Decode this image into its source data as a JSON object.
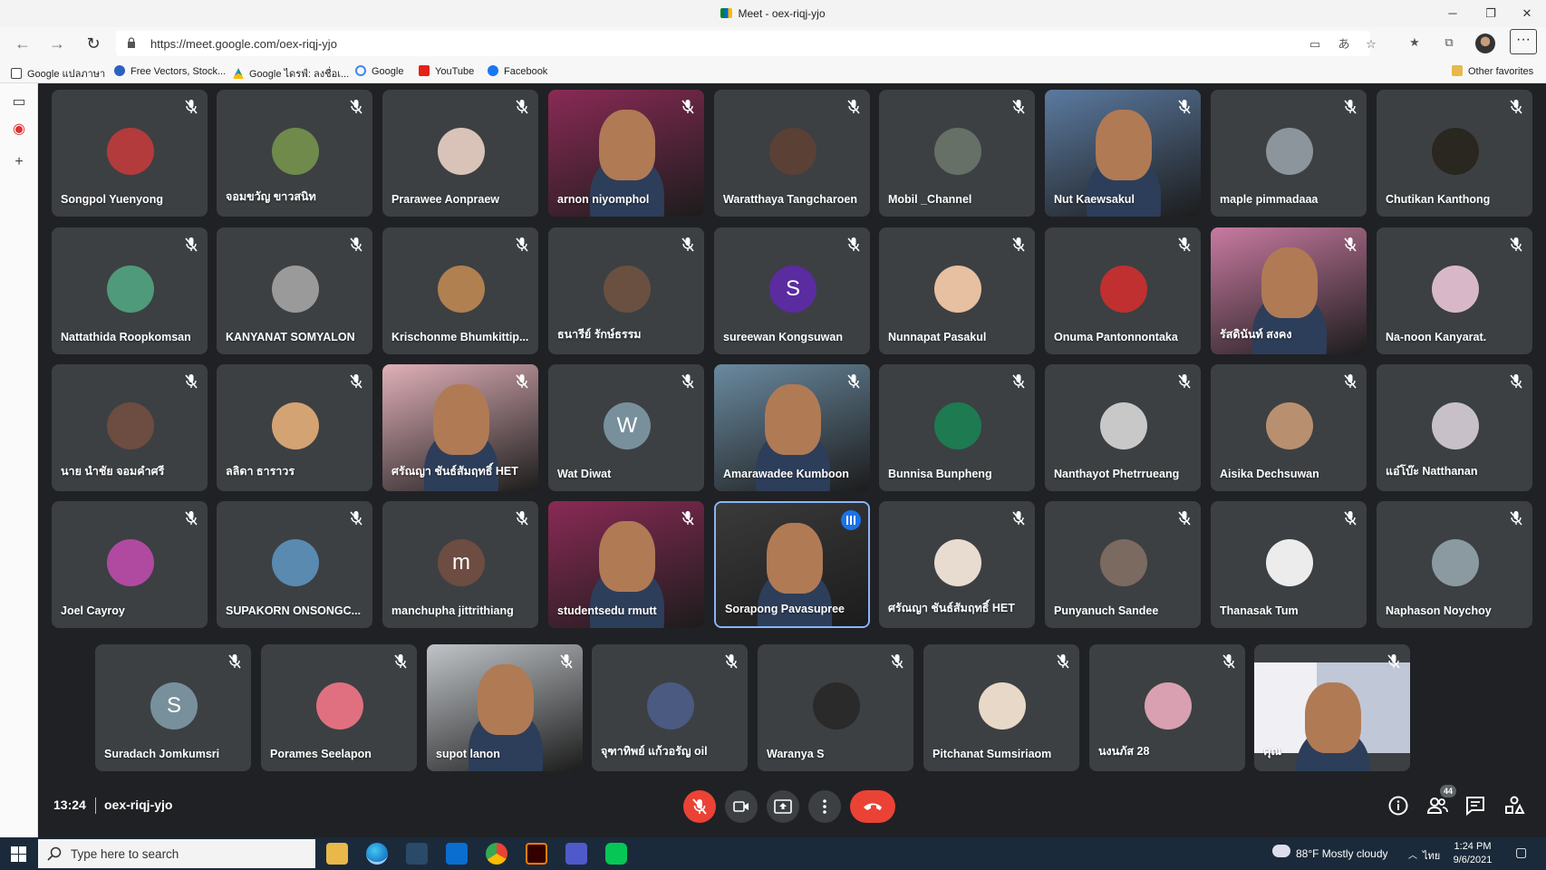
{
  "window": {
    "title": "Meet - oex-riqj-yjo",
    "minimize": "─",
    "maximize": "❐",
    "close": "✕"
  },
  "address_bar": {
    "url": "https://meet.google.com/oex-riqj-yjo",
    "back": "←",
    "forward": "→",
    "reload": "↻"
  },
  "favorites": [
    {
      "label": "Google แปลภาษา",
      "icon": "page-icon"
    },
    {
      "label": "Free Vectors, Stock...",
      "icon": "freepik-icon"
    },
    {
      "label": "Google ไดรฟ์: ลงชื่อเ...",
      "icon": "drive-icon"
    },
    {
      "label": "Google",
      "icon": "google-icon"
    },
    {
      "label": "YouTube",
      "icon": "youtube-icon"
    },
    {
      "label": "Facebook",
      "icon": "facebook-icon"
    },
    {
      "label": "Other favorites",
      "icon": "folder-icon"
    }
  ],
  "participants": [
    {
      "name": "Songpol Yuenyong",
      "type": "photo",
      "color": "#b33b3b"
    },
    {
      "name": "จอมขวัญ ขาวสนิท",
      "type": "photo",
      "color": "#6f8a4a"
    },
    {
      "name": "Prarawee Aonpraew",
      "type": "photo",
      "color": "#d9c3b8"
    },
    {
      "name": "arnon niyomphol",
      "type": "video",
      "color": "#8a2a55"
    },
    {
      "name": "Waratthaya Tangcharoen",
      "type": "photo",
      "color": "#5a4035"
    },
    {
      "name": "Mobil _Channel",
      "type": "photo",
      "color": "#667066"
    },
    {
      "name": "Nut Kaewsakul",
      "type": "video",
      "color": "#5b7aa0"
    },
    {
      "name": "maple pimmadaaa",
      "type": "photo",
      "color": "#8c949c"
    },
    {
      "name": "Chutikan Kanthong",
      "type": "photo",
      "color": "#2a2620"
    },
    {
      "name": "Nattathida Roopkomsan",
      "type": "photo",
      "color": "#4f9a7a"
    },
    {
      "name": "KANYANAT SOMYALON",
      "type": "photo",
      "color": "#9a9a9a"
    },
    {
      "name": "Krischonme Bhumkittip...",
      "type": "photo",
      "color": "#b08050"
    },
    {
      "name": "ธนารีย์ รักษ์ธรรม",
      "type": "photo",
      "color": "#6a5040"
    },
    {
      "name": "sureewan Kongsuwan",
      "type": "letter",
      "letter": "S",
      "color": "#5b2ba0"
    },
    {
      "name": "Nunnapat Pasakul",
      "type": "photo",
      "color": "#e6c0a0"
    },
    {
      "name": "Onuma Pantonnontaka",
      "type": "photo",
      "color": "#c03030"
    },
    {
      "name": "รัสดินันท์ สงคง",
      "type": "video",
      "color": "#c87aa0"
    },
    {
      "name": "Na-noon Kanyarat.",
      "type": "photo",
      "color": "#d8b8c8"
    },
    {
      "name": "นาย นำชัย จอมคำศรี",
      "type": "photo",
      "color": "#6d4c41"
    },
    {
      "name": "ลลิดา ธาราวร",
      "type": "photo",
      "color": "#d4a373"
    },
    {
      "name": "ศรัณญา ชันธ์สัมฤทธิ์ HET",
      "type": "video",
      "color": "#e0b0b8"
    },
    {
      "name": "Wat Diwat",
      "type": "letter",
      "letter": "W",
      "color": "#78909c"
    },
    {
      "name": "Amarawadee Kumboon",
      "type": "video",
      "color": "#6a8aa0"
    },
    {
      "name": "Bunnisa Bunpheng",
      "type": "photo",
      "color": "#1e7a50"
    },
    {
      "name": "Nanthayot Phetrrueang",
      "type": "photo",
      "color": "#c8c8c8"
    },
    {
      "name": "Aisika Dechsuwan",
      "type": "photo",
      "color": "#b89070"
    },
    {
      "name": "แอ๋โบ๊ะ Natthanan",
      "type": "photo",
      "color": "#c8c0c8"
    },
    {
      "name": "Joel Cayroy",
      "type": "photo",
      "color": "#b04aa0"
    },
    {
      "name": "SUPAKORN ONSONGC...",
      "type": "photo",
      "color": "#5a8ab0"
    },
    {
      "name": "manchupha jittrithiang",
      "type": "letter",
      "letter": "m",
      "color": "#6d4c41"
    },
    {
      "name": "studentsedu rmutt",
      "type": "video",
      "color": "#8a2a55"
    },
    {
      "name": "Sorapong Pavasupree",
      "type": "video",
      "color": "#3a3a3a",
      "speaking": true
    },
    {
      "name": "ศรัณญา ชันธ์สัมฤทธิ์ HET",
      "type": "photo",
      "color": "#e8dcd0"
    },
    {
      "name": "Punyanuch Sandee",
      "type": "photo",
      "color": "#7a6a60"
    },
    {
      "name": "Thanasak Tum",
      "type": "photo",
      "color": "#ececec"
    },
    {
      "name": "Naphason Noychoy",
      "type": "photo",
      "color": "#8a9aa0"
    },
    {
      "name": "Suradach Jomkumsri",
      "type": "letter",
      "letter": "S",
      "color": "#78909c"
    },
    {
      "name": "Porames Seelapon",
      "type": "photo",
      "color": "#e07080"
    },
    {
      "name": "supot lanon",
      "type": "video",
      "color": "#c0c4c8"
    },
    {
      "name": "จุฑาทิพย์ แก้วอรัญ oil",
      "type": "photo",
      "color": "#4a5a80"
    },
    {
      "name": "Waranya S",
      "type": "photo",
      "color": "#2a2a2a"
    },
    {
      "name": "Pitchanat Sumsiriaom",
      "type": "photo",
      "color": "#e8d8c8"
    },
    {
      "name": "นงนภัส 28",
      "type": "photo",
      "color": "#d8a0b0"
    },
    {
      "name": "คุณ",
      "type": "video",
      "color": "#dce0e8",
      "self": true
    }
  ],
  "meeting": {
    "time": "13:24",
    "code": "oex-riqj-yjo",
    "participant_count": "44"
  },
  "taskbar": {
    "search_placeholder": "Type here to search",
    "weather": "88°F  Mostly cloudy",
    "lang": "ไทย",
    "time": "1:24 PM",
    "date": "9/6/2021"
  },
  "colors": {
    "meet_bg": "#202124",
    "tile_bg": "#3c4043",
    "hangup_red": "#ea4335",
    "speaking_blue": "#8ab4f8"
  }
}
